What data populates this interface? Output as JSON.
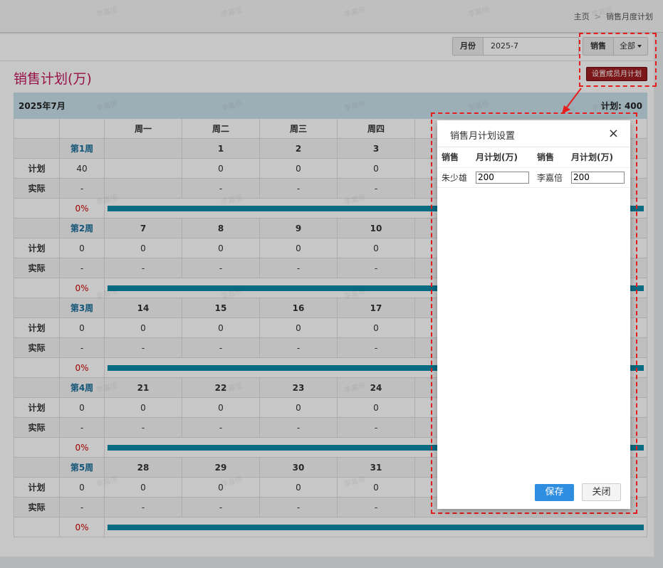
{
  "breadcrumb": {
    "home": "主页",
    "sep": ">",
    "current": "销售月度计划"
  },
  "toolbar": {
    "month_label": "月份",
    "month_value": "2025-7",
    "sales_label": "销售",
    "sales_value": "全部"
  },
  "page_title": "销售计划(万)",
  "set_button": "设置成员月计划",
  "calendar": {
    "title": "2025年7月",
    "total": "计划: 400",
    "weekdays": [
      "周一",
      "周二",
      "周三",
      "周四"
    ],
    "plan_label": "计划",
    "actual_label": "实际",
    "weeks": [
      {
        "label": "第1周",
        "days": [
          "",
          "1",
          "2",
          "3"
        ],
        "week_plan": "40",
        "plans": [
          "",
          "0",
          "0",
          "0"
        ],
        "actual": "-",
        "actuals": [
          "",
          "-",
          "-",
          "-"
        ],
        "pct": "0%"
      },
      {
        "label": "第2周",
        "days": [
          "7",
          "8",
          "9",
          "10"
        ],
        "week_plan": "0",
        "plans": [
          "0",
          "0",
          "0",
          "0"
        ],
        "actual": "-",
        "actuals": [
          "-",
          "-",
          "-",
          "-"
        ],
        "pct": "0%"
      },
      {
        "label": "第3周",
        "days": [
          "14",
          "15",
          "16",
          "17"
        ],
        "week_plan": "0",
        "plans": [
          "0",
          "0",
          "0",
          "0"
        ],
        "actual": "-",
        "actuals": [
          "-",
          "-",
          "-",
          "-"
        ],
        "pct": "0%"
      },
      {
        "label": "第4周",
        "days": [
          "21",
          "22",
          "23",
          "24"
        ],
        "week_plan": "0",
        "plans": [
          "0",
          "0",
          "0",
          "0"
        ],
        "actual": "-",
        "actuals": [
          "-",
          "-",
          "-",
          "-"
        ],
        "pct": "0%"
      },
      {
        "label": "第5周",
        "days": [
          "28",
          "29",
          "30",
          "31"
        ],
        "week_plan": "0",
        "plans": [
          "0",
          "0",
          "0",
          "0"
        ],
        "actual": "-",
        "actuals": [
          "-",
          "-",
          "-",
          "-"
        ],
        "pct": "0%"
      }
    ]
  },
  "modal": {
    "title": "销售月计划设置",
    "close_icon": "×",
    "col_sales": "销售",
    "col_plan": "月计划(万)",
    "rows": [
      {
        "name1": "朱少雄",
        "plan1": "200",
        "name2": "李嘉倍",
        "plan2": "200"
      }
    ],
    "save_label": "保存",
    "close_label": "关闭"
  },
  "watermark": "李嘉倍",
  "colors": {
    "accent": "#c2185b",
    "primary": "#2f8ee0",
    "danger": "#9e1e21",
    "bar": "#0a8aa6",
    "highlight": "#e61e1e"
  }
}
